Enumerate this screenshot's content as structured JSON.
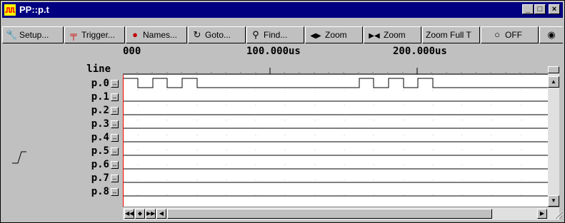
{
  "window": {
    "title": "PP::p.t"
  },
  "toolbar": {
    "buttons": [
      {
        "label": "Setup...",
        "icon": "wrench-icon",
        "glyph": "🔧"
      },
      {
        "label": "Trigger...",
        "icon": "trigger-icon",
        "glyph": "╤"
      },
      {
        "label": "Names...",
        "icon": "names-icon",
        "glyph": "●"
      },
      {
        "label": "Goto...",
        "icon": "goto-icon",
        "glyph": "↻"
      },
      {
        "label": "Find...",
        "icon": "binoculars-icon",
        "glyph": "⚲"
      },
      {
        "label": "Zoom",
        "icon": "zoom-out-icon",
        "glyph": "◀▶"
      },
      {
        "label": "Zoom",
        "icon": "zoom-in-icon",
        "glyph": "▶◀"
      },
      {
        "label": "Zoom Full T",
        "icon": "",
        "glyph": ""
      },
      {
        "label": "OFF",
        "icon": "off-circle-icon",
        "glyph": "○"
      },
      {
        "label": "",
        "icon": "record-icon",
        "glyph": "◉"
      }
    ]
  },
  "ruler": {
    "labels": [
      "000",
      "100.000us",
      "200.000us"
    ]
  },
  "signals": {
    "header": "line",
    "names": [
      "p.0",
      "p.1",
      "p.2",
      "p.3",
      "p.4",
      "p.5",
      "p.6",
      "p.7",
      "p.8"
    ]
  },
  "colors": {
    "title_bg": "#000080",
    "cursor_line": "#ff0000",
    "wave": "#000000"
  }
}
